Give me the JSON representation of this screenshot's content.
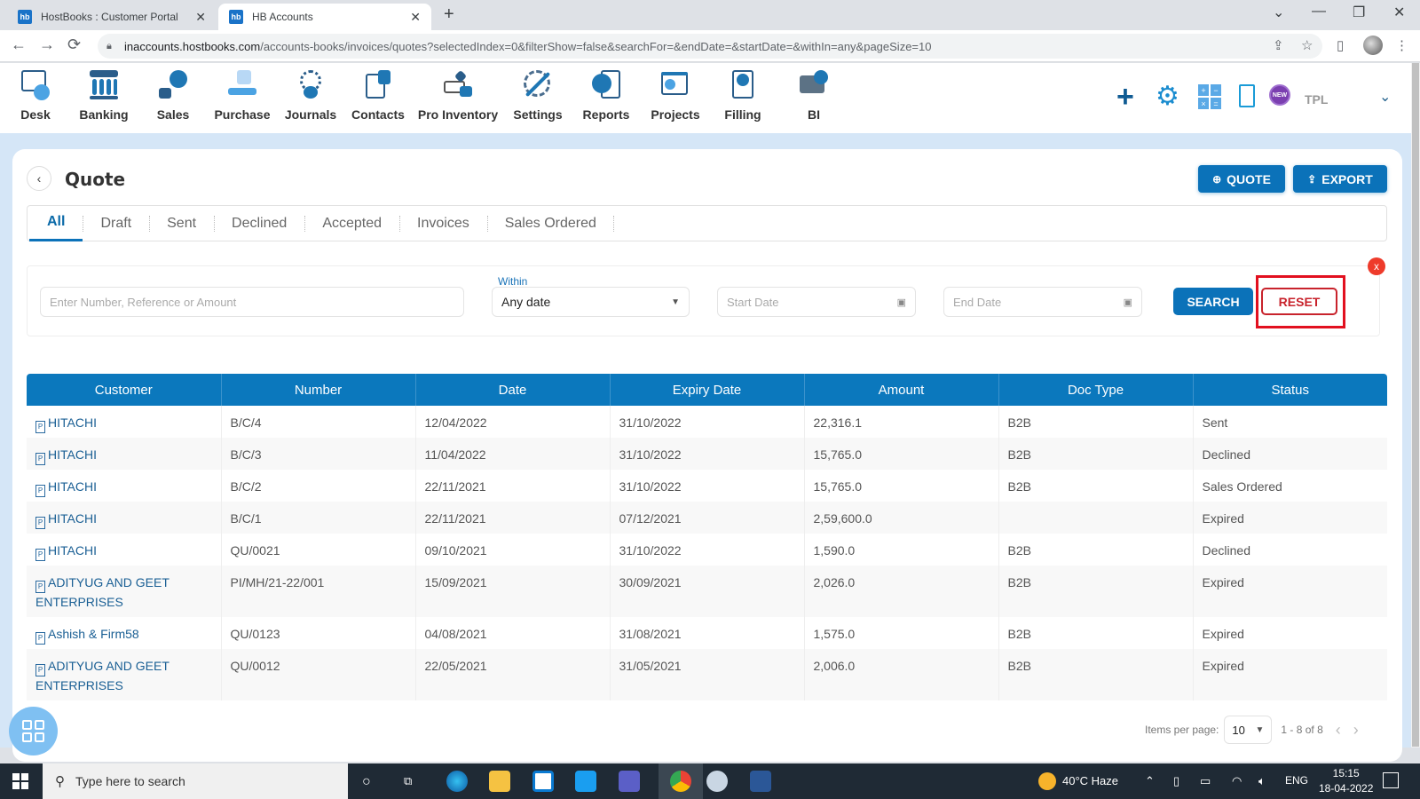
{
  "browser": {
    "tabs": [
      {
        "title": "HostBooks : Customer Portal",
        "favicon": "hb",
        "active": false
      },
      {
        "title": "HB Accounts",
        "favicon": "hb",
        "active": true
      }
    ],
    "new_tab": "+",
    "url_host": "inaccounts.hostbooks.com",
    "url_path": "/accounts-books/invoices/quotes?selectedIndex=0&filterShow=false&searchFor=&endDate=&startDate=&withIn=any&pageSize=10",
    "icons": {
      "back": "←",
      "forward": "→",
      "reload": "⟳",
      "share": "⇪",
      "star": "☆",
      "sidepanel": "▯",
      "menu": "⋮",
      "tab_search": "⌄",
      "minimize": "—",
      "restore": "❐",
      "close": "✕"
    }
  },
  "app_nav": {
    "items": [
      {
        "label": "Desk",
        "icon": "desk-icon"
      },
      {
        "label": "Banking",
        "icon": "bank-icon"
      },
      {
        "label": "Sales",
        "icon": "sales-icon"
      },
      {
        "label": "Purchase",
        "icon": "purchase-icon"
      },
      {
        "label": "Journals",
        "icon": "journals-icon"
      },
      {
        "label": "Contacts",
        "icon": "contacts-icon"
      },
      {
        "label": "Pro Inventory",
        "icon": "inventory-icon"
      },
      {
        "label": "Settings",
        "icon": "settings-icon"
      },
      {
        "label": "Reports",
        "icon": "reports-icon"
      },
      {
        "label": "Projects",
        "icon": "projects-icon"
      },
      {
        "label": "Filling",
        "icon": "filling-icon"
      },
      {
        "label": "BI",
        "icon": "bi-icon"
      }
    ],
    "right": {
      "plus": "+",
      "gear": "⚙",
      "calc": [
        "+",
        "−",
        "×",
        "="
      ],
      "new_badge": "NEW",
      "company": "TPL",
      "chevron": "⌄"
    }
  },
  "page": {
    "title": "Quote",
    "back": "‹",
    "buttons": {
      "quote": "QUOTE",
      "quote_icon": "⊕",
      "export": "EXPORT",
      "export_icon": "⇪"
    },
    "tabs": [
      "All",
      "Draft",
      "Sent",
      "Declined",
      "Accepted",
      "Invoices",
      "Sales Ordered"
    ],
    "active_tab": "All"
  },
  "filters": {
    "search_placeholder": "Enter Number, Reference or Amount",
    "within_label": "Within",
    "within_value": "Any date",
    "start_date_placeholder": "Start Date",
    "end_date_placeholder": "End Date",
    "search_button": "SEARCH",
    "reset_button": "RESET",
    "close": "x"
  },
  "table": {
    "columns": [
      "Customer",
      "Number",
      "Date",
      "Expiry Date",
      "Amount",
      "Doc Type",
      "Status"
    ],
    "rows": [
      {
        "customer": "HITACHI",
        "number": "B/C/4",
        "date": "12/04/2022",
        "expiry": "31/10/2022",
        "amount": "22,316.1",
        "doc_type": "B2B",
        "status": "Sent"
      },
      {
        "customer": "HITACHI",
        "number": "B/C/3",
        "date": "11/04/2022",
        "expiry": "31/10/2022",
        "amount": "15,765.0",
        "doc_type": "B2B",
        "status": "Declined"
      },
      {
        "customer": "HITACHI",
        "number": "B/C/2",
        "date": "22/11/2021",
        "expiry": "31/10/2022",
        "amount": "15,765.0",
        "doc_type": "B2B",
        "status": "Sales Ordered"
      },
      {
        "customer": "HITACHI",
        "number": "B/C/1",
        "date": "22/11/2021",
        "expiry": "07/12/2021",
        "amount": "2,59,600.0",
        "doc_type": "",
        "status": "Expired"
      },
      {
        "customer": "HITACHI",
        "number": "QU/0021",
        "date": "09/10/2021",
        "expiry": "31/10/2022",
        "amount": "1,590.0",
        "doc_type": "B2B",
        "status": "Declined"
      },
      {
        "customer": "ADITYUG AND GEET ENTERPRISES",
        "number": "PI/MH/21-22/001",
        "date": "15/09/2021",
        "expiry": "30/09/2021",
        "amount": "2,026.0",
        "doc_type": "B2B",
        "status": "Expired"
      },
      {
        "customer": "Ashish & Firm58",
        "number": "QU/0123",
        "date": "04/08/2021",
        "expiry": "31/08/2021",
        "amount": "1,575.0",
        "doc_type": "B2B",
        "status": "Expired"
      },
      {
        "customer": "ADITYUG AND GEET ENTERPRISES",
        "number": "QU/0012",
        "date": "22/05/2021",
        "expiry": "31/05/2021",
        "amount": "2,006.0",
        "doc_type": "B2B",
        "status": "Expired"
      }
    ]
  },
  "pagination": {
    "items_per_page_label": "Items per page:",
    "items_per_page": "10",
    "range": "1 - 8 of 8",
    "prev": "‹",
    "next": "›"
  },
  "taskbar": {
    "search_placeholder": "Type here to search",
    "weather": "40°C  Haze",
    "language": "ENG",
    "time": "15:15",
    "date": "18-04-2022"
  },
  "colors": {
    "primary": "#0b72b9",
    "reset_red": "#c8232c",
    "highlight_red": "#e2101f",
    "link": "#1a5f94"
  }
}
